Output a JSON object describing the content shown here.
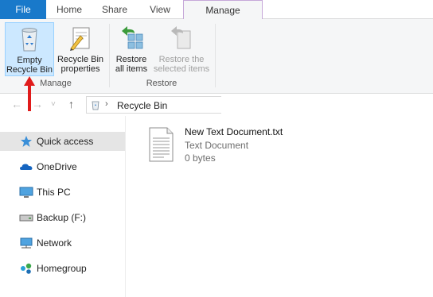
{
  "tabs": {
    "file": "File",
    "home": "Home",
    "share": "Share",
    "view": "View",
    "manage": "Manage"
  },
  "ribbon": {
    "empty_recycle_bin": "Empty Recycle Bin",
    "empty_line1": "Empty",
    "empty_line2": "Recycle Bin",
    "properties_line1": "Recycle Bin",
    "properties_line2": "properties",
    "restore_all_line1": "Restore",
    "restore_all_line2": "all items",
    "restore_sel_line1": "Restore the",
    "restore_sel_line2": "selected items",
    "group_manage": "Manage",
    "group_restore": "Restore",
    "icons": {
      "empty": "recycle-bin-icon",
      "properties": "properties-icon",
      "restore_all": "restore-all-icon",
      "restore_selected": "restore-selected-icon"
    }
  },
  "address": {
    "path": "Recycle Bin"
  },
  "nav": {
    "items": [
      {
        "label": "Quick access",
        "icon": "star-icon"
      },
      {
        "label": "OneDrive",
        "icon": "cloud-icon"
      },
      {
        "label": "This PC",
        "icon": "computer-icon"
      },
      {
        "label": "Backup (F:)",
        "icon": "drive-icon"
      },
      {
        "label": "Network",
        "icon": "network-icon"
      },
      {
        "label": "Homegroup",
        "icon": "homegroup-icon"
      }
    ]
  },
  "content": {
    "files": [
      {
        "name": "New Text Document.txt",
        "type": "Text Document",
        "size": "0 bytes"
      }
    ]
  },
  "colors": {
    "file_tab": "#1979ca",
    "selected_button": "#cce8ff",
    "annotation_arrow": "#e01b1b",
    "selected_nav": "#e5e5e5"
  }
}
